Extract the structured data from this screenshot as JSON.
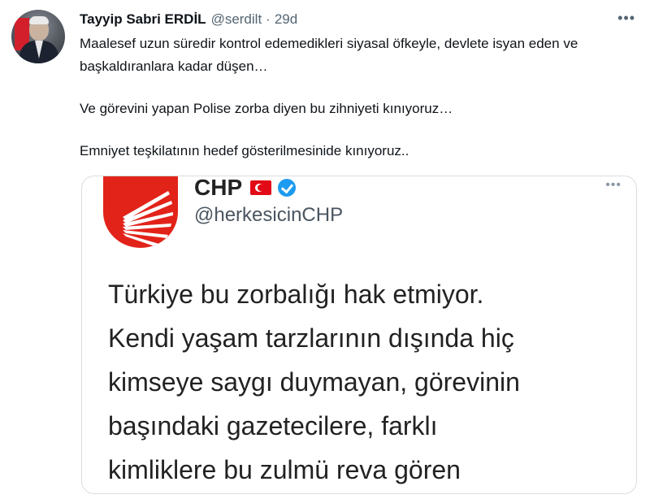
{
  "tweet": {
    "author_name": "Tayyip Sabri ERDİL",
    "handle": "@serdilt",
    "separator": "·",
    "time": "29d",
    "more_icon": "more-horizontal-icon",
    "paragraphs": [
      "Maalesef uzun süredir kontrol edemedikleri siyasal öfkeyle, devlete isyan eden ve başkaldıranlara kadar düşen…",
      "Ve görevini yapan Polise zorba diyen bu zihniyeti kınıyoruz…",
      "Emniyet teşkilatının hedef gösterilmesinide kınıyoruz.."
    ]
  },
  "embedded": {
    "name": "CHP",
    "handle": "@herkesicinCHP",
    "flag_icon": "turkey-flag-icon",
    "verified_icon": "verified-badge-icon",
    "logo": "chp-logo",
    "more_icon": "more-horizontal-icon",
    "lines": [
      "Türkiye bu zorbalığı hak etmiyor.",
      "Kendi yaşam tarzlarının dışında hiç",
      "kimseye saygı duymayan, görevinin",
      "başındaki gazetecilere, farklı",
      "kimliklere bu zulmü reva gören"
    ]
  },
  "colors": {
    "text": "#0f1419",
    "muted": "#536471",
    "chp_red": "#e2231a",
    "verified_blue": "#1d9bf0"
  }
}
